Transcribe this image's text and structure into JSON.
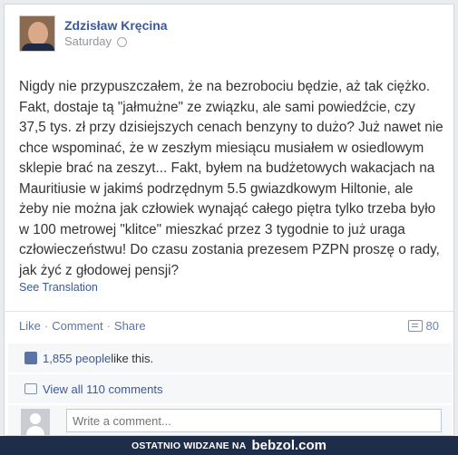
{
  "post": {
    "author": "Zdzisław Kręcina",
    "time": "Saturday",
    "text": "Nigdy nie przypuszczałem, że na bezrobociu będzie, aż tak ciężko. Fakt, dostaje tą \"jałmużne\" ze związku, ale sami powiedźcie, czy 37,5 tys. zł przy dzisiejszych cenach benzyny to dużo? Już nawet nie chce wspominać, że w zeszłym miesiącu musiałem w osiedlowym sklepie brać na zeszyt... Fakt, byłem na budżetowych wakacjach na Mauritiusie w jakimś podrzędnym 5.5 gwiazdkowym Hiltonie, ale żeby nie można jak człowiek wynająć całego piętra tylko trzeba było w 100 metrowej \"klitce\" mieszkać przez 3 tygodnie to już uraga człowieczeństwu! Do czasu zostania prezesem PZPN proszę o rady, jak żyć z głodowej pensji?",
    "see_translation": "See Translation"
  },
  "actions": {
    "like": "Like",
    "comment": "Comment",
    "share": "Share",
    "separator": "·",
    "comment_count": "80"
  },
  "likes": {
    "count_link": "1,855 people",
    "suffix": " like this."
  },
  "comments": {
    "view_all": "View all 110 comments",
    "write_placeholder": "Write a comment..."
  },
  "footer": {
    "label": "OSTATNIO WIDZANE NA",
    "brand": "bebzol.com"
  },
  "icons": {
    "globe": "globe-icon",
    "thumb": "like-thumb-icon",
    "comment": "comment-bubble-icon"
  },
  "colors": {
    "link": "#3b5998",
    "footer_bg": "#1d2d4a"
  }
}
